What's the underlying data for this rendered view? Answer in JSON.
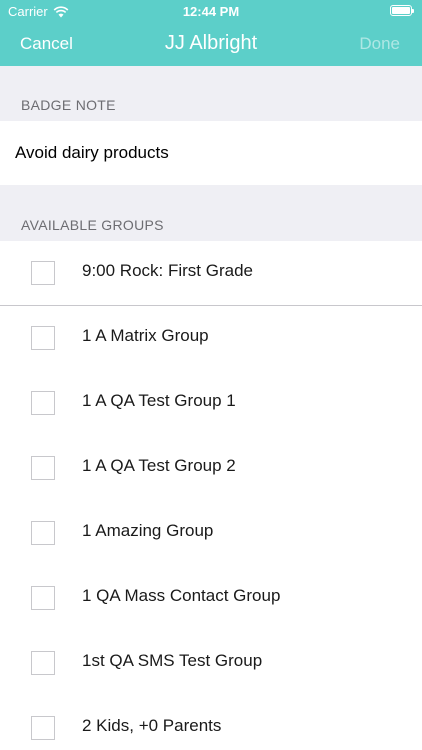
{
  "theme": {
    "accent": "#5ccfc9"
  },
  "status_bar": {
    "carrier": "Carrier",
    "time": "12:44 PM",
    "wifi_icon": "wifi-icon",
    "battery_icon": "battery-icon"
  },
  "nav": {
    "cancel_label": "Cancel",
    "title": "JJ Albright",
    "done_label": "Done"
  },
  "badge_note": {
    "header": "BADGE NOTE",
    "value": "Avoid dairy products"
  },
  "groups": {
    "header": "AVAILABLE GROUPS",
    "items": [
      {
        "label": "9:00 Rock: First Grade",
        "checked": false
      },
      {
        "label": "1 A Matrix Group",
        "checked": false
      },
      {
        "label": "1 A QA Test Group 1",
        "checked": false
      },
      {
        "label": "1 A QA Test Group 2",
        "checked": false
      },
      {
        "label": "1 Amazing Group",
        "checked": false
      },
      {
        "label": "1 QA Mass Contact Group",
        "checked": false
      },
      {
        "label": "1st QA SMS Test Group",
        "checked": false
      },
      {
        "label": "2 Kids, +0 Parents",
        "checked": false
      }
    ]
  }
}
